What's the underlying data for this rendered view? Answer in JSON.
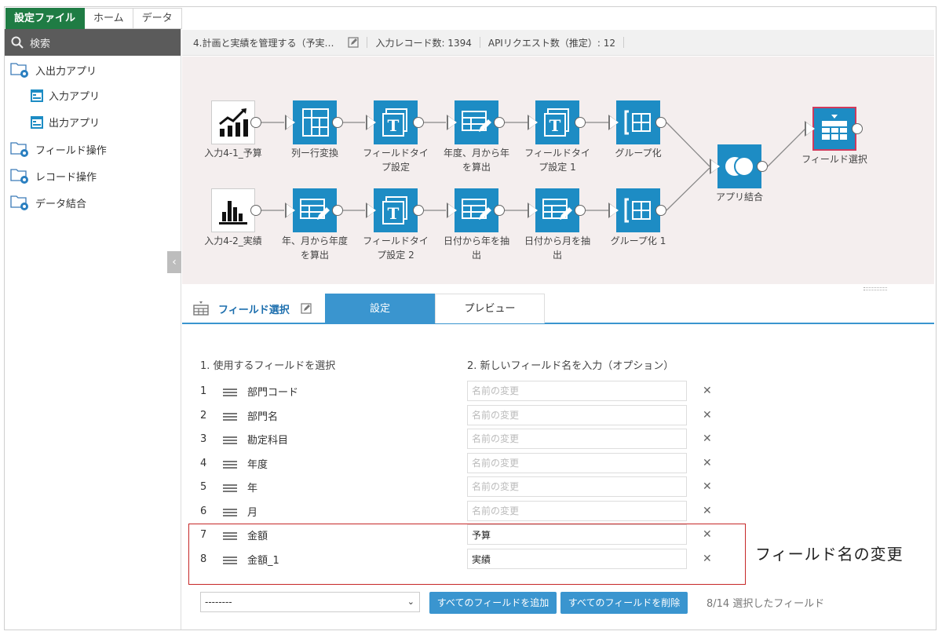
{
  "tabs": [
    "設定ファイル",
    "ホーム",
    "データ"
  ],
  "sidebar": {
    "search_placeholder": "検索",
    "items": [
      {
        "label": "入出力アプリ",
        "icon": "folder-gear-icon"
      },
      {
        "label": "入力アプリ",
        "icon": "app-icon"
      },
      {
        "label": "出力アプリ",
        "icon": "app-icon"
      },
      {
        "label": "フィールド操作",
        "icon": "folder-gear-icon"
      },
      {
        "label": "レコード操作",
        "icon": "folder-gear-icon"
      },
      {
        "label": "データ結合",
        "icon": "folder-gear-icon"
      }
    ]
  },
  "topbar": {
    "title": "4.計画と実績を管理する（予実…",
    "records": "入力レコード数: 1394",
    "api": "APIリクエスト数（推定）: 12"
  },
  "nodes": {
    "n1": "入力4-1_予算",
    "n2": "列ー行変換",
    "n3a": "フィールドタイ",
    "n3b": "プ設定",
    "n4a": "年度、月から年",
    "n4b": "を算出",
    "n5a": "フィールドタイ",
    "n5b": "プ設定 1",
    "n6": "グループ化",
    "n7": "アプリ結合",
    "n8": "フィールド選択",
    "m1": "入力4-2_実績",
    "m2a": "年、月から年度",
    "m2b": "を算出",
    "m3a": "フィールドタイ",
    "m3b": "プ設定 2",
    "m4a": "日付から年を抽",
    "m4b": "出",
    "m5a": "日付から月を抽",
    "m5b": "出",
    "m6": "グループ化 1"
  },
  "panel": {
    "title": "フィールド選択",
    "tab_settings": "設定",
    "tab_preview": "プレビュー",
    "col1": "1. 使用するフィールドを選択",
    "col2": "2. 新しいフィールド名を入力（オプション）",
    "placeholder": "名前の変更",
    "rows": [
      {
        "num": "1",
        "field": "部門コード",
        "value": ""
      },
      {
        "num": "2",
        "field": "部門名",
        "value": ""
      },
      {
        "num": "3",
        "field": "勘定科目",
        "value": ""
      },
      {
        "num": "4",
        "field": "年度",
        "value": ""
      },
      {
        "num": "5",
        "field": "年",
        "value": ""
      },
      {
        "num": "6",
        "field": "月",
        "value": ""
      },
      {
        "num": "7",
        "field": "金額",
        "value": "予算"
      },
      {
        "num": "8",
        "field": "金額_1",
        "value": "実績"
      }
    ],
    "select_value": "--------",
    "add_all": "すべてのフィールドを追加",
    "remove_all": "すべてのフィールドを削除",
    "count": "8/14 選択したフィールド"
  },
  "annotation": "フィールド名の変更",
  "colors": {
    "accent": "#3a95cf",
    "node": "#1d8cc4",
    "brand": "#1f7c44",
    "highlight": "#c62828"
  }
}
